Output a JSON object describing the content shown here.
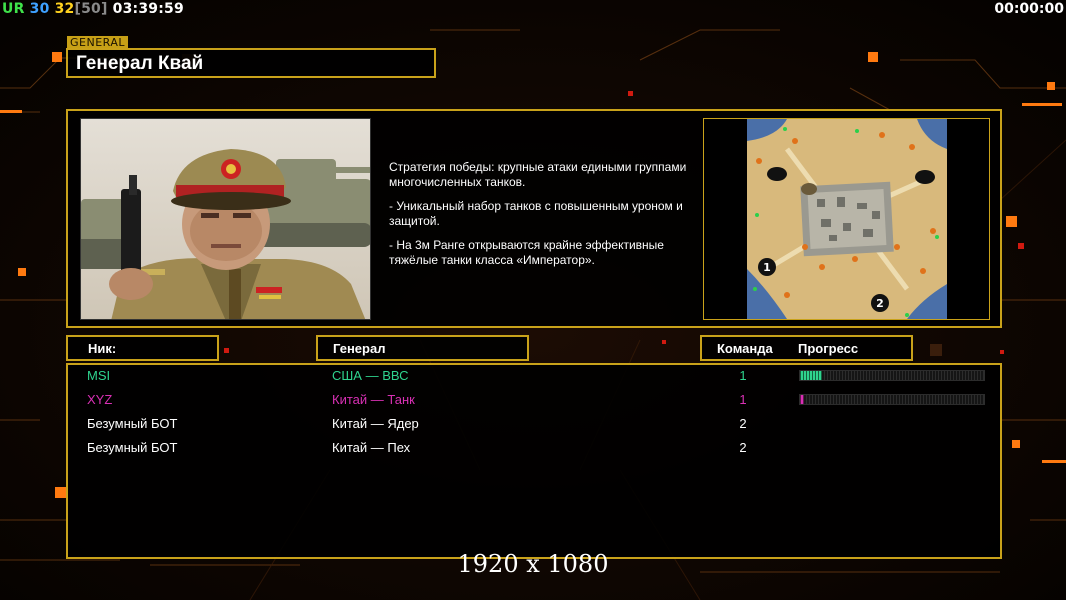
{
  "hud": {
    "ur": "UR",
    "value1": "30",
    "value2": "32",
    "value3": "[50]",
    "clock": "03:39:59",
    "timer": "00:00:00"
  },
  "general": {
    "tag": "GENERAL",
    "name": "Генерал Квай",
    "description": [
      "Стратегия победы: крупные атаки едиными группами многочисленных танков.",
      "- Уникальный набор танков с повышенным уроном и защитой.",
      "- На 3м Ранге открываются крайне эффективные тяжёлые танки класса «Император»."
    ]
  },
  "map": {
    "start_1": "1",
    "start_2": "2"
  },
  "columns": {
    "nick": "Ник:",
    "general": "Генерал",
    "team": "Команда",
    "progress": "Прогресс"
  },
  "players": [
    {
      "nick": "MSI",
      "general": "США — ВВС",
      "team": "1",
      "color": "#2fd38e",
      "progress": 0.12
    },
    {
      "nick": "XYZ",
      "general": "Китай — Танк",
      "team": "1",
      "color": "#d930b4",
      "progress": 0.02
    },
    {
      "nick": "Безумный БОТ",
      "general": "Китай — Ядер",
      "team": "2",
      "color": "#ffffff",
      "progress": null
    },
    {
      "nick": "Безумный БОТ",
      "general": "Китай — Пех",
      "team": "2",
      "color": "#ffffff",
      "progress": null
    }
  ],
  "footer": {
    "resolution": "1920 x 1080"
  },
  "colors": {
    "frame": "#c9a21a",
    "accent_orange": "#ff7a10"
  }
}
